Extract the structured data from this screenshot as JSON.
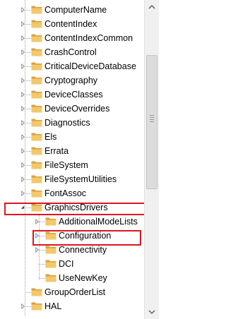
{
  "tree": {
    "items": [
      {
        "label": "ComputerName",
        "depth": 0,
        "state": "collapsed"
      },
      {
        "label": "ContentIndex",
        "depth": 0,
        "state": "collapsed"
      },
      {
        "label": "ContentIndexCommon",
        "depth": 0,
        "state": "collapsed"
      },
      {
        "label": "CrashControl",
        "depth": 0,
        "state": "collapsed"
      },
      {
        "label": "CriticalDeviceDatabase",
        "depth": 0,
        "state": "collapsed"
      },
      {
        "label": "Cryptography",
        "depth": 0,
        "state": "collapsed"
      },
      {
        "label": "DeviceClasses",
        "depth": 0,
        "state": "collapsed"
      },
      {
        "label": "DeviceOverrides",
        "depth": 0,
        "state": "collapsed"
      },
      {
        "label": "Diagnostics",
        "depth": 0,
        "state": "collapsed"
      },
      {
        "label": "Els",
        "depth": 0,
        "state": "collapsed"
      },
      {
        "label": "Errata",
        "depth": 0,
        "state": "collapsed"
      },
      {
        "label": "FileSystem",
        "depth": 0,
        "state": "collapsed"
      },
      {
        "label": "FileSystemUtilities",
        "depth": 0,
        "state": "collapsed"
      },
      {
        "label": "FontAssoc",
        "depth": 0,
        "state": "collapsed"
      },
      {
        "label": "GraphicsDrivers",
        "depth": 0,
        "state": "expanded",
        "highlighted": true
      },
      {
        "label": "AdditionalModeLists",
        "depth": 1,
        "state": "collapsed"
      },
      {
        "label": "Configuration",
        "depth": 1,
        "state": "collapsed",
        "highlighted": true
      },
      {
        "label": "Connectivity",
        "depth": 1,
        "state": "collapsed"
      },
      {
        "label": "DCI",
        "depth": 1,
        "state": "leaf"
      },
      {
        "label": "UseNewKey",
        "depth": 1,
        "state": "leaf"
      },
      {
        "label": "GroupOrderList",
        "depth": 0,
        "state": "leaf"
      },
      {
        "label": "HAL",
        "depth": 0,
        "state": "collapsed"
      }
    ]
  },
  "colors": {
    "highlight_box": "#e0141e",
    "folder_fill": "#f3c86a",
    "folder_dark": "#d9a13c"
  },
  "icons": {
    "folder": "folder-icon",
    "expand": "expand-arrow-icon",
    "collapse": "collapse-arrow-icon",
    "scroll_up": "scroll-up-icon",
    "scroll_down": "scroll-down-icon"
  }
}
